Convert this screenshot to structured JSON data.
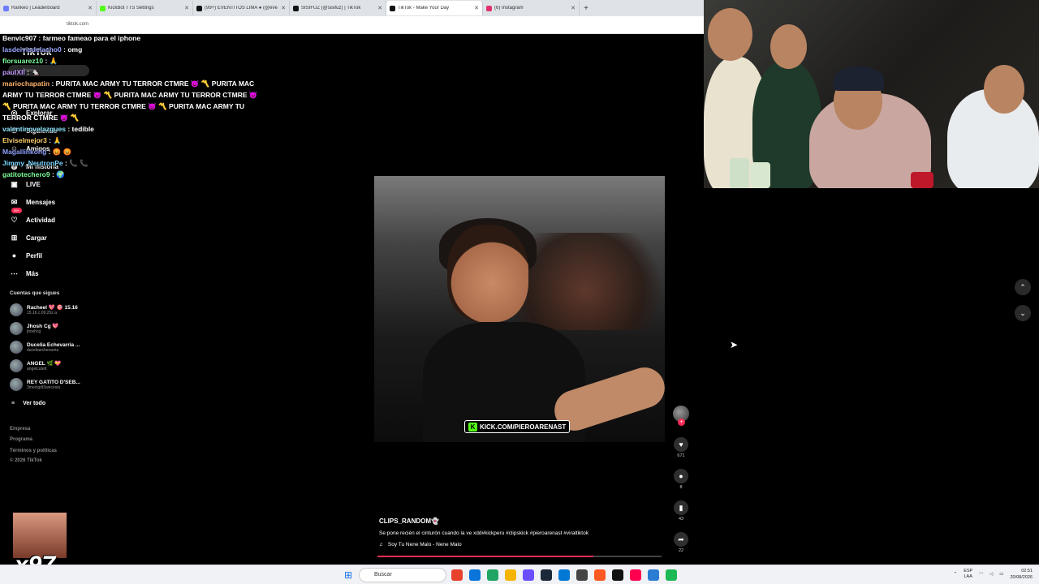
{
  "browser": {
    "tabs": [
      {
        "title": "Rankeo | Leaderboard",
        "color": "#6b7cff",
        "active": false
      },
      {
        "title": "KickBot TTS Settings",
        "color": "#53fc18",
        "active": false
      },
      {
        "title": "(99+) EVENTITOS LIMA ● (@eve",
        "color": "#111111",
        "active": false
      },
      {
        "title": "SISIFUZ (@sisifuz) | TikTok",
        "color": "#111111",
        "active": false
      },
      {
        "title": "TikTok - Make Your Day",
        "color": "#111111",
        "active": true
      },
      {
        "title": "(6) Instagram",
        "color": "#e1306c",
        "active": false
      }
    ],
    "address": "tiktok.com"
  },
  "sidebar": {
    "logo": "TikTok",
    "search_placeholder": "Buscar",
    "nav": [
      {
        "label": "Explorar",
        "icon": "compass-icon",
        "glyph": "◎"
      },
      {
        "label": "Siguiendo",
        "icon": "following-icon",
        "glyph": "⚇"
      },
      {
        "label": "Amigos",
        "icon": "friends-icon",
        "glyph": "☺"
      },
      {
        "label": "Mi historia",
        "icon": "story-icon",
        "glyph": "◍"
      },
      {
        "label": "LIVE",
        "icon": "live-icon",
        "glyph": "▣"
      },
      {
        "label": "Mensajes",
        "icon": "messages-icon",
        "glyph": "✉"
      },
      {
        "label": "Actividad",
        "icon": "activity-icon",
        "glyph": "♡"
      },
      {
        "label": "Cargar",
        "icon": "upload-icon",
        "glyph": "⊞"
      },
      {
        "label": "Perfil",
        "icon": "profile-icon",
        "glyph": "●"
      },
      {
        "label": "Más",
        "icon": "more-icon",
        "glyph": "⋯"
      }
    ],
    "activity_badge": "99+",
    "following_title": "Cuentas que sigues",
    "accounts": [
      {
        "name": "Racheel 💖 🎯 15.16",
        "handle": "15.16.c.09.25z.a"
      },
      {
        "name": "Jhosh Cg 💖",
        "handle": "jhoshcg"
      },
      {
        "name": "Ducelia Echevarria ...",
        "handle": "duceliaechevarria"
      },
      {
        "name": "ANGEL 🌿 💝",
        "handle": "angelcutett"
      },
      {
        "name": "REY GATITO D'SEB...",
        "handle": "3meclgdt3wecestu"
      }
    ],
    "see_all": "Ver todo",
    "footer": [
      "Empresa",
      "Programa",
      "Términos y políticas",
      "© 2026 TikTok"
    ]
  },
  "chat": [
    {
      "user": "Benvic907",
      "color": "#ffffff",
      "msg": "farmeo fameao para el iphone"
    },
    {
      "user": "lasdeivisdelacho0",
      "color": "#9aa7ff",
      "msg": "omg"
    },
    {
      "user": "florsuarez10",
      "color": "#7dff9a",
      "msg": "🙏"
    },
    {
      "user": "paulXII",
      "color": "#c39bff",
      "msg": "🐁"
    },
    {
      "user": "mariochapatin",
      "color": "#ffb36b",
      "msg": "PURITA MAC ARMY TU TERROR CTMRE 👿 〽️ PURITA MAC ARMY TU TERROR CTMRE 👿 〽️ PURITA MAC ARMY TU TERROR CTMRE 👿 〽️ PURITA MAC ARMY TU TERROR CTMRE 👿 〽️ PURITA MAC ARMY TU TERROR CTMRE 👿 〽️"
    },
    {
      "user": "valentinovelazques",
      "color": "#8fe6ff",
      "msg": "tedible"
    },
    {
      "user": "Elviselmejor3",
      "color": "#ffd36b",
      "msg": "🙏"
    },
    {
      "user": "Magallinkong",
      "color": "#8ea0ff",
      "msg": "😡 😡"
    },
    {
      "user": "Jimmy_NeutronPe",
      "color": "#7ad7ff",
      "msg": "📞 📞"
    },
    {
      "user": "gatitotechero9",
      "color": "#7dff9a",
      "msg": "🌍"
    }
  ],
  "video": {
    "overlay_tag": "KICK.COM/PIEROARENAST",
    "username": "CLIPS_RANDOM👻",
    "description": "Se pone recién el cinturón cuando la ve xdd#kickperu #clipskick #pieroarenast #viraltiktok",
    "music": "Soy Tu Nene Malo - Nene Malo",
    "progress": 0.76,
    "likes": "671",
    "comments": "8",
    "saves": "43",
    "shares": "22"
  },
  "emote": {
    "count": "x97"
  },
  "taskbar": {
    "search": "Buscar",
    "apps": [
      "#e8412c",
      "#0a74da",
      "#1fa463",
      "#f4b400",
      "#6b4eff",
      "#1b2838",
      "#0078d4",
      "#444444",
      "#ff5722",
      "#111111",
      "#ff0050",
      "#2b7cd3",
      "#1db954"
    ],
    "lang_top": "ESP",
    "lang_bottom": "LAA",
    "time": "02:51",
    "date": "20/08/2026"
  }
}
